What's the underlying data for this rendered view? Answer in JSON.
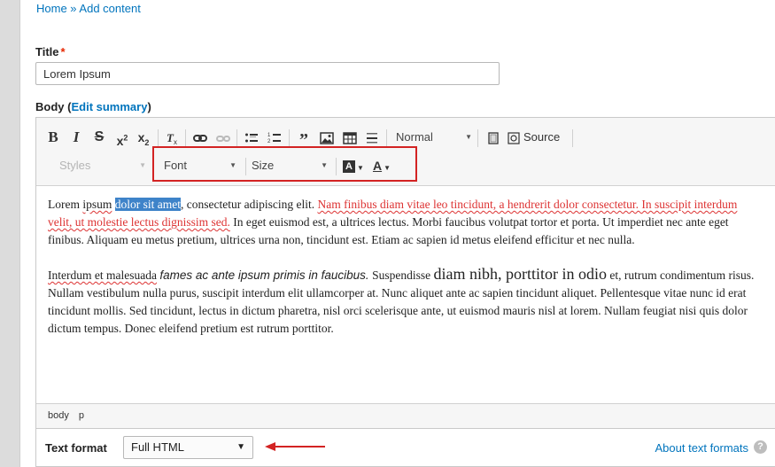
{
  "breadcrumb": "Home » Add content",
  "title_field": {
    "label": "Title",
    "required_mark": "*",
    "value": "Lorem Ipsum"
  },
  "body_field": {
    "label": "Body",
    "edit_summary": "Edit summary",
    "paren_open": "(",
    "paren_close": ")"
  },
  "toolbar": {
    "bold": "B",
    "italic": "I",
    "strike": "S",
    "superscript": "x",
    "subscript": "x",
    "remove_format": "Tx",
    "link": "link",
    "unlink": "unlink",
    "bulleted_list": "bulleted list",
    "numbered_list": "numbered list",
    "blockquote": "99",
    "image": "image",
    "table": "table",
    "horizontal_rule": "horizontal rule",
    "format_combo": "Normal",
    "maximize": "maximize",
    "source": "Source",
    "styles_combo": "Styles",
    "font_combo": "Font",
    "size_combo": "Size",
    "bg_color": "A",
    "text_color": "A"
  },
  "content": {
    "p1": {
      "t1": "Lorem",
      "t2": "ipsum",
      "selected": "dolor sit amet",
      "t3": ", consectetur adipiscing elit.",
      "red1": "Nam finibus diam vitae leo tincidunt, a hendrerit dolor consectetur. In suscipit interdum velit, ut molestie lectus dignissim sed.",
      "t4": "In eget euismod est, a ultrices lectus. Morbi faucibus volutpat tortor et porta. Ut imperdiet nec ante eget finibus. Aliquam eu metus pretium, ultrices urna non, tincidunt est. Etiam ac sapien id metus eleifend efficitur et nec nulla."
    },
    "p2": {
      "t1": "Interdum et malesuada",
      "italic": "fames ac ante ipsum primis in faucibus.",
      "t2": "Suspendisse",
      "big": "diam nibh, porttitor in odio",
      "t3": "et, rutrum condimentum risus. Nullam vestibulum nulla purus, suscipit interdum elit ullamcorper at. Nunc aliquet ante ac sapien tincidunt aliquet. Pellentesque vitae nunc id erat tincidunt mollis. Sed tincidunt, lectus in dictum pharetra, nisl orci scelerisque ante, ut euismod mauris nisl at lorem. Nullam feugiat nisi quis dolor dictum tempus. Donec eleifend pretium est rutrum porttitor."
    }
  },
  "pathbar": [
    "body",
    "p"
  ],
  "text_format": {
    "label": "Text format",
    "selected": "Full HTML",
    "about_link": "About text formats",
    "help": "?"
  },
  "colors": {
    "link": "#0074bd",
    "highlight_border": "#d32323",
    "selection": "#3e83c9",
    "required": "#e62600"
  }
}
